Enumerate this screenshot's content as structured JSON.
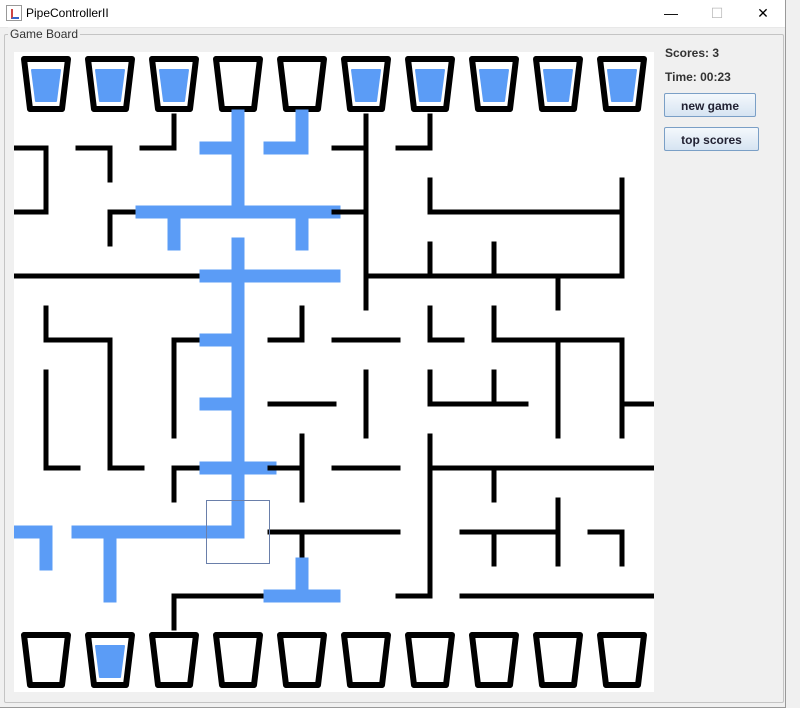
{
  "window": {
    "title": "PipeControllerII",
    "minimize_glyph": "—",
    "maximize_glyph": "☐",
    "close_glyph": "✕"
  },
  "game_board": {
    "label": "Game Board"
  },
  "stats": {
    "score": "Scores: 3",
    "time": "Time: 00:23"
  },
  "buttons": {
    "new_game": "new game",
    "top_scores": "top scores"
  },
  "colors": {
    "pipe": "#000000",
    "water": "#5b9cf6",
    "board_bg": "#ffffff",
    "selection": "#6a7faa"
  },
  "board": {
    "cols": 10,
    "rows": 8,
    "top_cups_filled": [
      true,
      true,
      true,
      false,
      false,
      true,
      true,
      true,
      true,
      true
    ],
    "bottom_cups_filled": [
      false,
      true,
      false,
      false,
      false,
      false,
      false,
      false,
      false,
      false
    ],
    "selected_cell": {
      "col": 3,
      "row": 6
    },
    "tiles": [
      [
        "sw",
        "sw",
        "nw",
        "nsW",
        "nW",
        "nsw",
        "nw",
        "",
        "",
        ""
      ],
      [
        "wn",
        "se",
        "esW",
        "neW",
        "eSw",
        "nsw",
        "ne",
        "ew",
        "ew",
        "nsw"
      ],
      [
        "ew",
        "ew",
        "ew",
        "nesW",
        "eW",
        "nes",
        "new",
        "new",
        "esw",
        "nw"
      ],
      [
        "ne",
        "sw",
        "es",
        "nsW",
        "nw",
        "ew",
        "ne",
        "ne",
        "ews",
        "sw"
      ],
      [
        "ns",
        "ns",
        "ns",
        "nsW",
        "ew",
        "ns",
        "ne",
        "new",
        "ns",
        "nes"
      ],
      [
        "ne",
        "ne",
        "es",
        "eNsw",
        "nsw",
        "ew",
        "nes",
        "ews",
        "ew",
        "ew"
      ],
      [
        "wS",
        "sEW",
        "EW",
        "NW",
        "esw",
        "ew",
        "ns",
        "esw",
        "nsw",
        "sw"
      ],
      [
        "",
        "N",
        "es",
        "ew",
        "eNw",
        "",
        "nw",
        "ew",
        "ew",
        "ew"
      ]
    ]
  }
}
